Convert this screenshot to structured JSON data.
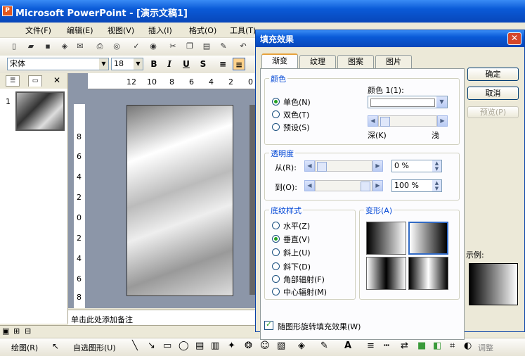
{
  "app": {
    "title": "Microsoft PowerPoint - [演示文稿1]",
    "icon": "powerpoint-icon"
  },
  "menu": [
    "文件(F)",
    "编辑(E)",
    "视图(V)",
    "插入(I)",
    "格式(O)",
    "工具(T)"
  ],
  "format_toolbar": {
    "font": "宋体",
    "size": "18",
    "bold": "B",
    "italic": "I",
    "underline": "U",
    "shadow": "S"
  },
  "panel": {
    "slide_number": "1"
  },
  "ruler": {
    "h_ticks": [
      "12",
      "10",
      "8",
      "6",
      "4",
      "2",
      "0"
    ],
    "v_ticks": [
      "8",
      "6",
      "4",
      "2",
      "0",
      "2",
      "4",
      "6",
      "8"
    ]
  },
  "notes": {
    "placeholder": "单击此处添加备注"
  },
  "drawing_toolbar": {
    "draw": "绘图(R)",
    "autoshape": "自选图形(U)",
    "adjust": "调整"
  },
  "dialog": {
    "title": "填充效果",
    "tabs": [
      "渐变",
      "纹理",
      "图案",
      "图片"
    ],
    "active_tab": "渐变",
    "colors_group": "颜色",
    "color_options": [
      "单色(N)",
      "双色(T)",
      "预设(S)"
    ],
    "selected_color_option": "单色(N)",
    "color1_label": "颜色 1(1):",
    "dark_label": "深(K)",
    "light_label": "浅",
    "transparency_group": "透明度",
    "from_label": "从(R):",
    "from_value": "0 %",
    "to_label": "到(O):",
    "to_value": "100 %",
    "shading_group": "底纹样式",
    "shading_options": [
      "水平(Z)",
      "垂直(V)",
      "斜上(U)",
      "斜下(D)",
      "角部辐射(F)",
      "中心辐射(M)"
    ],
    "selected_shading": "垂直(V)",
    "variants_label": "变形(A)",
    "sample_label": "示例:",
    "ok": "确定",
    "cancel": "取消",
    "preview": "预览(P)",
    "rotate_checkbox": "随图形旋转填充效果(W)",
    "rotate_checked": true
  }
}
